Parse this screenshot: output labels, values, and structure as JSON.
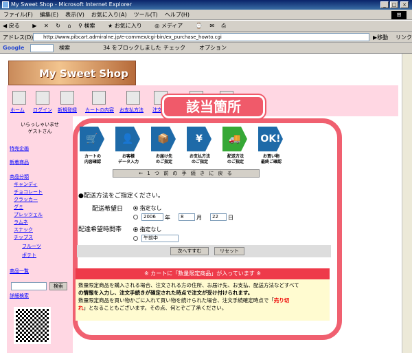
{
  "window": {
    "title": "My Sweet Shop - Microsoft Internet Explorer"
  },
  "menu": [
    "ファイル(F)",
    "編集(E)",
    "表示(V)",
    "お気に入り(A)",
    "ツール(T)",
    "ヘルプ(H)"
  ],
  "toolbar": {
    "back": "戻る",
    "search": "検索",
    "favorites": "お気に入り",
    "media": "メディア"
  },
  "address": {
    "label": "アドレス(D)",
    "url": "http://www.pibcart.admiralne.jp/e-commex/cgi-bin/ex_purchase_howto.cgi",
    "go": "移動",
    "links": "リンク"
  },
  "google": {
    "label": "Google",
    "search": "検索",
    "blocked": "34 をブロックしました",
    "check": "チェック",
    "options": "オプション"
  },
  "shop": {
    "logo": "My Sweet Shop"
  },
  "nav": [
    "ホーム",
    "ログイン",
    "新規登録",
    "カートの内容",
    "お支払方法",
    "注文方..."
  ],
  "overlay_badge": "該当箇所",
  "sidebar": {
    "welcome_1": "いらっしゃいませ",
    "welcome_2": "ゲストさん",
    "special": "特売企画",
    "new": "新着商品",
    "categories": "商品分類",
    "items": [
      "キャンディ",
      "チョコレート",
      "クラッカー",
      "グミ",
      "プレッツェル",
      "ラムネ",
      "スナック",
      "チップス"
    ],
    "subitems": [
      "フルーツ",
      "ポテト"
    ],
    "list": "商品一覧",
    "search_button": "検索",
    "advanced": "詳細検索"
  },
  "steps": [
    {
      "label": "カートの\n内容確認",
      "icon": "cart-icon"
    },
    {
      "label": "お客様\nデータ入力",
      "icon": "person-icon"
    },
    {
      "label": "お届け先\nのご指定",
      "icon": "box-icon"
    },
    {
      "label": "お支払方法\nのご指定",
      "icon": "card-icon"
    },
    {
      "label": "配送方法\nのご指定",
      "icon": "truck-icon"
    },
    {
      "label": "お買い物\n最終ご確認",
      "icon": "ok-icon"
    }
  ],
  "back_button": "← 1 つ 前 の 手 続 き に 戻 る",
  "section_title": "●配送方法をご指定ください。",
  "delivery_date": {
    "label": "配送希望日",
    "option_none": "指定なし",
    "year": "2006",
    "year_unit": "年",
    "month": "8",
    "month_unit": "月",
    "day": "22",
    "day_unit": "日"
  },
  "delivery_time": {
    "label": "配達希望時間帯",
    "option_none": "指定なし",
    "time": "午前中"
  },
  "buttons": {
    "next": "次へすすむ",
    "reset": "リセット"
  },
  "notice": {
    "head": "※ カートに「数量限定商品」が入っています ※",
    "line1": "数量限定商品を購入される場合、注文される方の住所、お届け先、お支払、配送方法などすべて",
    "line2": "の情報を入力し、注文手続きが確定された時点で注文が受け付けられます。",
    "line3": "数量限定商品を買い物かごに入れて買い物を続けられた場合、注文手続確定時点で「売り切",
    "line4": "れ」となることもございます。その点、何とぞご了承ください。",
    "red_word": "売り切",
    "red_word2": "れ"
  }
}
